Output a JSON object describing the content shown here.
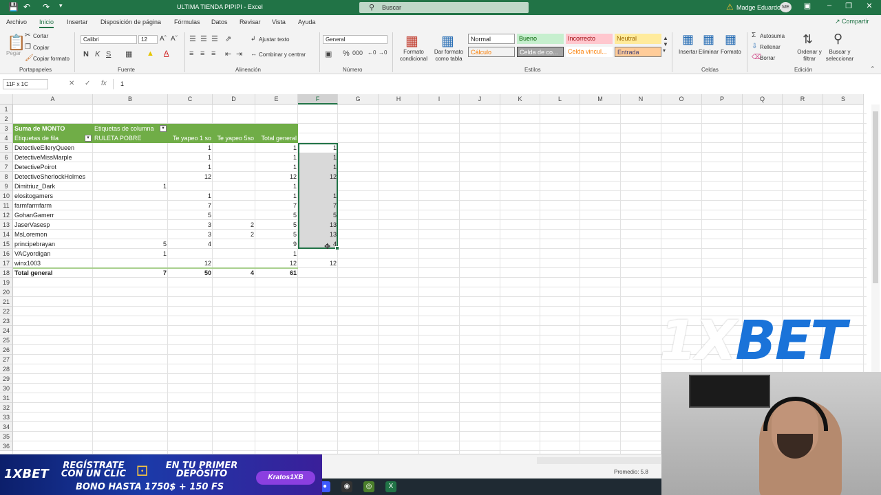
{
  "titlebar": {
    "title": "ULTIMA TIENDA PIPIPI  -  Excel",
    "search_placeholder": "Buscar",
    "user": "Madge Eduardo",
    "initials": "ME",
    "accent": "#217346"
  },
  "tabs": [
    "Archivo",
    "Inicio",
    "Insertar",
    "Disposición de página",
    "Fórmulas",
    "Datos",
    "Revisar",
    "Vista",
    "Ayuda"
  ],
  "share_label": "Compartir",
  "ribbon": {
    "portapapeles": {
      "paste": "Pegar",
      "cut": "Cortar",
      "copy": "Copiar",
      "format_painter": "Copiar formato",
      "label": "Portapapeles"
    },
    "fuente": {
      "font": "Calibri",
      "size": "12",
      "label": "Fuente"
    },
    "alineacion": {
      "wrap": "Ajustar texto",
      "merge": "Combinar y centrar",
      "label": "Alineación"
    },
    "numero": {
      "format": "General",
      "label": "Número"
    },
    "estilos": {
      "cond": "Formato condicional",
      "table": "Dar formato como tabla",
      "label": "Estilos",
      "boxes": [
        "Normal",
        "Bueno",
        "Incorrecto",
        "Neutral",
        "Cálculo",
        "Celda de co...",
        "Celda vincul...",
        "Entrada"
      ]
    },
    "celdas": {
      "insert": "Insertar",
      "delete": "Eliminar",
      "format": "Formato",
      "label": "Celdas"
    },
    "edicion": {
      "autosum": "Autosuma",
      "fill": "Rellenar",
      "clear": "Borrar",
      "sort": "Ordenar y filtrar",
      "find": "Buscar y seleccionar",
      "label": "Edición"
    }
  },
  "formula": {
    "namebox": "11F x 1C",
    "value": "1"
  },
  "columns": [
    "A",
    "B",
    "C",
    "D",
    "E",
    "F",
    "G",
    "H",
    "I",
    "J",
    "K",
    "L",
    "M",
    "N",
    "O",
    "P",
    "Q",
    "R",
    "S"
  ],
  "rows": [
    "1",
    "2",
    "3",
    "4",
    "5",
    "6",
    "7",
    "8",
    "9",
    "10",
    "11",
    "12",
    "13",
    "14",
    "15",
    "16",
    "17",
    "18",
    "19",
    "20",
    "21",
    "22",
    "23",
    "24",
    "25",
    "26",
    "27",
    "28",
    "29",
    "30",
    "31",
    "32",
    "33",
    "34",
    "35",
    "36"
  ],
  "pivot": {
    "sum_label": "Suma de MONTO",
    "col_labels": "Etiquetas de columna",
    "row_labels": "Etiquetas de fila",
    "headers": [
      "RULETA POBRE",
      "Te yapeo 1 so",
      "Te yapeo 5so",
      "Total general"
    ],
    "data": [
      {
        "name": "DetectiveElleryQueen",
        "b": "",
        "c": "1",
        "d": "",
        "e": "1",
        "f": "1"
      },
      {
        "name": "DetectiveMissMarple",
        "b": "",
        "c": "1",
        "d": "",
        "e": "1",
        "f": "1"
      },
      {
        "name": "DetectivePoirot",
        "b": "",
        "c": "1",
        "d": "",
        "e": "1",
        "f": "1"
      },
      {
        "name": "DetectiveSherlockHolmes",
        "b": "",
        "c": "12",
        "d": "",
        "e": "12",
        "f": "12"
      },
      {
        "name": "Dimitriuz_Dark",
        "b": "1",
        "c": "",
        "d": "",
        "e": "1",
        "f": ""
      },
      {
        "name": "elositogamers",
        "b": "",
        "c": "1",
        "d": "",
        "e": "1",
        "f": "1"
      },
      {
        "name": "farmfarmfarm",
        "b": "",
        "c": "7",
        "d": "",
        "e": "7",
        "f": "7"
      },
      {
        "name": "GohanGamerr",
        "b": "",
        "c": "5",
        "d": "",
        "e": "5",
        "f": "5"
      },
      {
        "name": "JaserVasesp",
        "b": "",
        "c": "3",
        "d": "2",
        "e": "5",
        "f": "13"
      },
      {
        "name": "MsLoremon",
        "b": "",
        "c": "3",
        "d": "2",
        "e": "5",
        "f": "13"
      },
      {
        "name": "principebrayan",
        "b": "5",
        "c": "4",
        "d": "",
        "e": "9",
        "f": "4"
      },
      {
        "name": "VACyordigan",
        "b": "1",
        "c": "",
        "d": "",
        "e": "1",
        "f": ""
      },
      {
        "name": "winx1003",
        "b": "",
        "c": "12",
        "d": "",
        "e": "12",
        "f": "12"
      }
    ],
    "total": {
      "name": "Total general",
      "b": "7",
      "c": "50",
      "d": "4",
      "e": "61"
    }
  },
  "status": {
    "average": "Promedio: 5.8"
  },
  "overlays": {
    "logo_x": "1X",
    "logo_bet": "BET",
    "ad_brand": "1XBET",
    "ad_register": "REGÍSTRATE CON UN CLIC",
    "ad_deposit": "EN TU PRIMER DEPÓSITO",
    "ad_bonus": "BONO HASTA 1750$ + 150 FS",
    "ad_badge": "Kratos1XB"
  }
}
